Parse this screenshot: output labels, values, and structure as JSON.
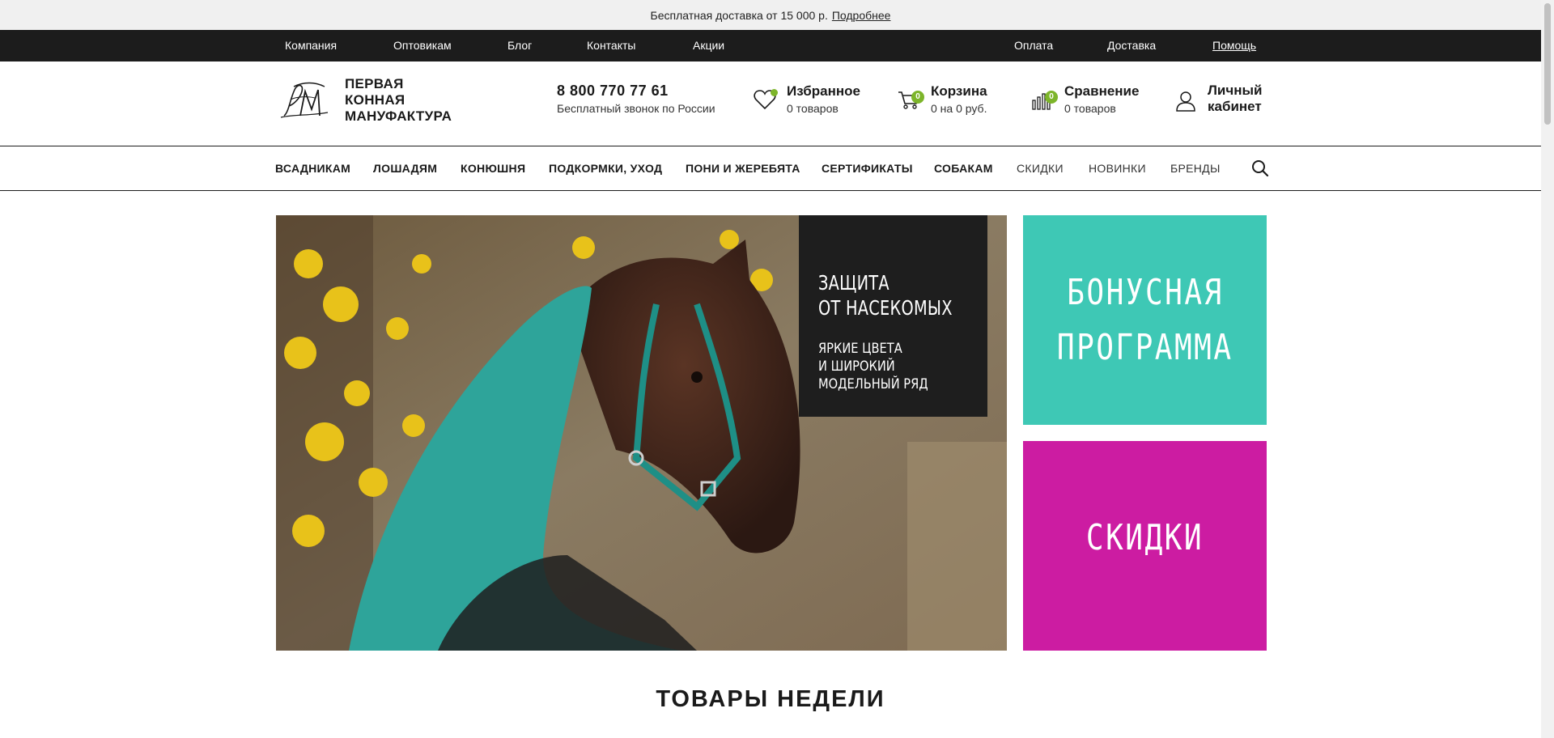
{
  "promo": {
    "text": "Бесплатная доставка от 15 000 р.",
    "link": "Подробнее"
  },
  "top_nav": {
    "left": [
      "Компания",
      "Оптовикам",
      "Блог",
      "Контакты",
      "Акции"
    ],
    "right": [
      "Оплата",
      "Доставка",
      "Помощь"
    ]
  },
  "header": {
    "logo_lines": [
      "ПЕРВАЯ",
      "КОННАЯ",
      "МАНУФАКТУРА"
    ],
    "phone": "8 800 770 77 61",
    "phone_sub": "Бесплатный звонок по России",
    "favorites": {
      "title": "Избранное",
      "sub": "0 товаров"
    },
    "cart": {
      "title": "Корзина",
      "sub": "0 на 0 руб.",
      "badge": "0"
    },
    "compare": {
      "title": "Сравнение",
      "sub": "0 товаров",
      "badge": "0"
    },
    "account": {
      "line1": "Личный",
      "line2": "кабинет"
    }
  },
  "categories": [
    "ВСАДНИКАМ",
    "ЛОШАДЯМ",
    "КОНЮШНЯ",
    "ПОДКОРМКИ, УХОД",
    "ПОНИ И ЖЕРЕБЯТА",
    "СЕРТИФИКАТЫ",
    "СОБАКАМ",
    "СКИДКИ",
    "НОВИНКИ",
    "БРЕНДЫ"
  ],
  "hero": {
    "title_lines": [
      "ЗАЩИТА",
      "ОТ НАСЕКОМЫХ"
    ],
    "sub_lines": [
      "ЯРКИЕ ЦВЕТА",
      "И ШИРОКИЙ",
      "МОДЕЛЬНЫЙ РЯД"
    ]
  },
  "banners": {
    "bonus_lines": [
      "БОНУСНАЯ",
      "ПРОГРАММА"
    ],
    "sale": "СКИДКИ"
  },
  "section_title": "ТОВАРЫ НЕДЕЛИ",
  "colors": {
    "accent_green": "#7db52a",
    "bonus_bg": "#3ec8b5",
    "sale_bg": "#cc1ca2",
    "dark": "#1c1c1c"
  }
}
